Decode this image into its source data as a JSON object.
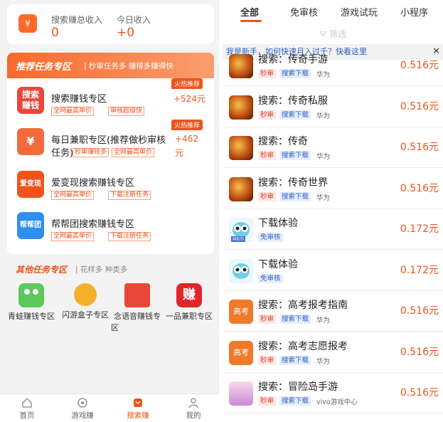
{
  "income": {
    "total_label": "搜索赚总收入",
    "total_value": "0",
    "today_label": "今日收入",
    "today_value": "+0",
    "icon": "yen-wallet-icon"
  },
  "recommended": {
    "title": "推荐任务专区",
    "subtitle": "| 秒审任务多 赚得多赚得快",
    "tasks": [
      {
        "name": "搜索赚钱专区",
        "logo_text": "搜索\n赚钱",
        "tags": [
          "全网最高单价",
          "审核超级快"
        ],
        "hot": "火热推荐",
        "reward": "+524元"
      },
      {
        "name": "每日兼职专区(推荐做秒审核",
        "name2": "任务)",
        "logo_text": "¥",
        "tags": [
          "秒审赚钱多",
          "全网最高单价"
        ],
        "hot": "火热推荐",
        "reward": "+462",
        "reward2": "元"
      },
      {
        "name": "爱变现搜索赚钱专区",
        "logo_text": "爱变现",
        "tags": [
          "全网最高单价",
          "下载注册任务"
        ]
      },
      {
        "name": "帮帮团搜索赚钱专区",
        "logo_text": "帮帮团",
        "tags": [
          "全网最高单价",
          "下载注册任务"
        ]
      }
    ]
  },
  "other": {
    "title": "其他任务专区",
    "subtitle": "| 花样多 种类多",
    "items": [
      {
        "label": "青蛙赚钱专区",
        "icon": "frog-icon"
      },
      {
        "label": "闪游盒子专区",
        "icon": "lion-icon"
      },
      {
        "label": "念语音赚钱专",
        "label2": "区",
        "icon": "red-envelope-icon"
      },
      {
        "label": "一品兼职专区",
        "icon": "zhuan-icon",
        "glyph": "赚"
      }
    ]
  },
  "tabbar": [
    {
      "label": "首页",
      "icon": "home-icon"
    },
    {
      "label": "游戏赚",
      "icon": "game-icon"
    },
    {
      "label": "搜索赚",
      "icon": "search-earn-icon",
      "active": true
    },
    {
      "label": "我的",
      "icon": "profile-icon"
    }
  ],
  "right": {
    "tabs": [
      "全部",
      "免审核",
      "游戏试玩",
      "小程序"
    ],
    "filter": "筛选",
    "notice": "我是新手，如何快速月入过千？快看这里",
    "close": "✕",
    "rows": [
      {
        "title": "搜索：传奇手游",
        "badges": [
          "秒审",
          "搜索下载"
        ],
        "platform": "华为",
        "price": "0.516元",
        "icon": "legend-game-icon"
      },
      {
        "title": "搜索：传奇私服",
        "badges": [
          "秒审",
          "搜索下载"
        ],
        "platform": "华为",
        "price": "0.516元",
        "icon": "legend-game-icon"
      },
      {
        "title": "搜索：传奇",
        "badges": [
          "秒审",
          "搜索下载"
        ],
        "platform": "华为",
        "price": "0.516元",
        "icon": "legend-game-icon"
      },
      {
        "title": "搜索：传奇世界",
        "badges": [
          "秒审",
          "搜索下载"
        ],
        "platform": "华为",
        "price": "0.516元",
        "icon": "legend-game-icon"
      },
      {
        "title": "下载体验",
        "badges": [
          "免审核"
        ],
        "platform": "",
        "price": "0.172元",
        "icon": "owl-mbti-icon",
        "icon_text": "MBTI"
      },
      {
        "title": "下载体验",
        "badges": [
          "免审核"
        ],
        "platform": "",
        "price": "0.172元",
        "icon": "owl-icon"
      },
      {
        "title": "搜索：高考报考指南",
        "badges": [
          "秒审",
          "搜索下载"
        ],
        "platform": "华为",
        "price": "0.516元",
        "icon": "gaokao-icon",
        "icon_text": "高考"
      },
      {
        "title": "搜索：高考志愿报考",
        "badges": [
          "秒审",
          "搜索下载"
        ],
        "platform": "华为",
        "price": "0.516元",
        "icon": "gaokao-icon",
        "icon_text": "高考"
      },
      {
        "title": "搜索：冒险岛手游",
        "badges": [
          "秒审",
          "搜索下载"
        ],
        "platform": "vivo游戏中心",
        "price": "0.516元",
        "icon": "maplestory-icon"
      }
    ]
  },
  "colors": {
    "accent": "#f0531c",
    "link": "#2a5fc9"
  }
}
